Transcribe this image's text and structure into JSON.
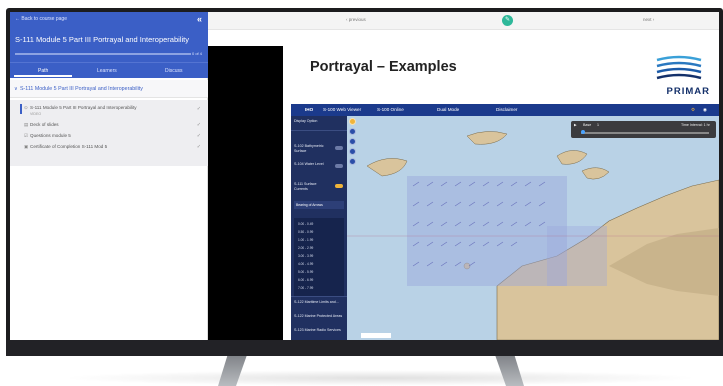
{
  "sidebar": {
    "back_label": "← Back to course page",
    "collapse_icon": "«",
    "course_title": "S-111 Module 5 Part III Portrayal and Interoperability",
    "progress_percent": 0,
    "progress_text": "0 of 4",
    "tabs": [
      {
        "label": "Path"
      },
      {
        "label": "Learners"
      },
      {
        "label": "Discuss"
      }
    ],
    "module": {
      "chevron": "∨",
      "label": "S-111 Module 5 Part III Portrayal and Interoperability"
    },
    "lessons": [
      {
        "label": "S-111 Module 5 Part III Portrayal and Interoperability",
        "sub": "VIDEO"
      },
      {
        "label": "Deck of slides",
        "sub": ""
      },
      {
        "label": "Questions module 5",
        "sub": ""
      },
      {
        "label": "Certificate of Completion S-111 Mod 5",
        "sub": ""
      }
    ]
  },
  "nav": {
    "previous": "‹ previous",
    "next": "next ›",
    "edit_icon": "✎"
  },
  "slide": {
    "title": "Portrayal – Examples",
    "logo_text": "PRIMAR"
  },
  "viewer": {
    "header": [
      "IHO",
      "S-100 Web Viewer",
      "S-100 Online",
      "Dual Mode",
      "Disclaimer"
    ],
    "panel": {
      "display_option": "Display Option",
      "groups": [
        {
          "label": "S-102 Bathymetric Surface"
        },
        {
          "label": "S-104 Water Level"
        },
        {
          "label": "S-111 Surface Currents"
        }
      ],
      "dropdown": "Bearing of Arrows",
      "legend": [
        "0.00 - 0.49",
        "0.50 - 0.99",
        "1.00 - 1.99",
        "2.00 - 2.99",
        "3.00 - 3.99",
        "4.00 - 4.99",
        "5.00 - 5.99",
        "6.00 - 6.99",
        "7.00 - 7.99"
      ],
      "bottom_groups": [
        {
          "label": "S-122 Maritime Limits and..."
        },
        {
          "label": "S-122 Marine Protected Areas"
        },
        {
          "label": "S-123 Marine Radio Services"
        }
      ]
    },
    "timebar": {
      "mode": "Base",
      "step": "1",
      "label": "Time Interval: 1 hr"
    }
  },
  "colors": {
    "brand": "#3b5fc6",
    "viewer_header": "#1b3a8c",
    "sea": "#b9d2e6",
    "land": "#d9c49c",
    "current_arrows": "#6b6fbf",
    "edit": "#2eb89a"
  }
}
